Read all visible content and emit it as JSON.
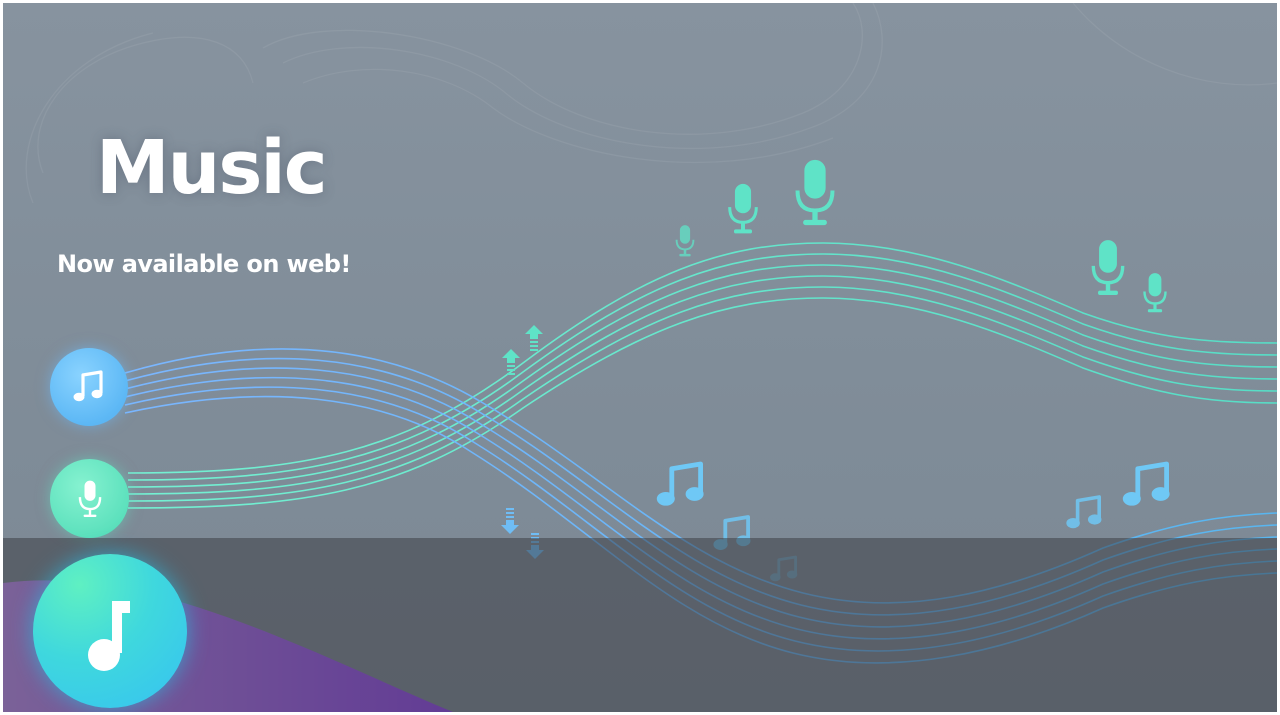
{
  "banner": {
    "title": "Music",
    "subtitle": "Now available on web!"
  },
  "icons": {
    "music_circle": "music-note-icon",
    "mic_circle": "microphone-icon",
    "app_icon": "music-note-icon",
    "floating_mics": "microphone-icon",
    "floating_notes": "music-notes-icon",
    "arrows": "arrow-icon"
  },
  "colors": {
    "background": "#838f9b",
    "teal_waves": "#5ee3c6",
    "blue_waves": "#5fa9ee",
    "purple_accent": "#9a4df2",
    "app_icon_gradient_start": "#5ff0c2",
    "app_icon_gradient_end": "#36c2f2"
  }
}
